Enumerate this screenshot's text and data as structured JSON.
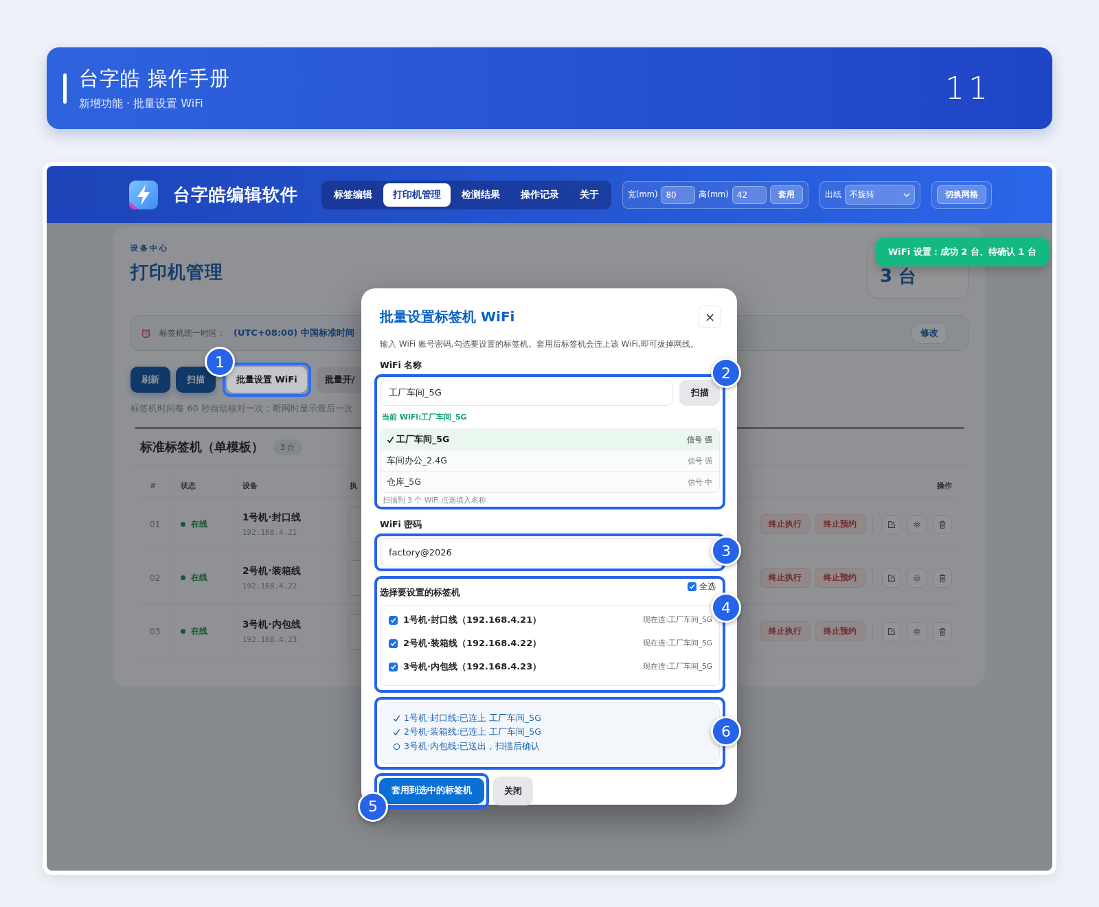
{
  "banner": {
    "title": "台字皓 操作手册",
    "subtitle": "新增功能 · 批量设置 WiFi",
    "page": "11"
  },
  "app": {
    "name": "台字皓编辑软件",
    "tabs": [
      {
        "label": "标签编辑",
        "selected": false
      },
      {
        "label": "打印机管理",
        "selected": true
      },
      {
        "label": "检测结果",
        "selected": false
      },
      {
        "label": "操作记录",
        "selected": false
      },
      {
        "label": "关于",
        "selected": false
      }
    ],
    "width_label": "宽(mm)",
    "width_value": "80",
    "height_label": "高(mm)",
    "height_value": "42",
    "apply_size": "套用",
    "paper_label": "出纸",
    "paper_value": "不旋转",
    "grid_button": "切换网格"
  },
  "page": {
    "eyebrow": "设备中心",
    "title": "打印机管理",
    "stat": "3 台",
    "timezone": {
      "label": "标签机统一时区：",
      "value": "(UTC+08:00) 中国标准时间",
      "edit": "修改"
    },
    "actions": [
      {
        "label": "刷新",
        "kind": "primary"
      },
      {
        "label": "扫描",
        "kind": "primary"
      },
      {
        "label": "批量设置 WiFi",
        "kind": "secondary",
        "callout": "1"
      },
      {
        "label": "批量开/",
        "kind": "secondary"
      }
    ],
    "hint": "标签机时间每 60 秒自动核对一次；断网时显示最后一次",
    "section": {
      "title": "标准标签机（单模板）",
      "count": "3 台"
    },
    "table": {
      "columns": [
        "#",
        "状态",
        "设备",
        "执"
      ],
      "actions_column": "操作",
      "rows": [
        {
          "index": "01",
          "status": "在线",
          "online": true,
          "name": "1号机·封口线",
          "ip": "192.168.4.21",
          "buttons": [
            "终止执行",
            "终止预约"
          ]
        },
        {
          "index": "02",
          "status": "在线",
          "online": true,
          "name": "2号机·装箱线",
          "ip": "192.168.4.22",
          "buttons": [
            "终止执行",
            "终止预约"
          ]
        },
        {
          "index": "03",
          "status": "在线",
          "online": true,
          "name": "3号机·内包线",
          "ip": "192.168.4.23",
          "buttons": [
            "终止执行",
            "终止预约"
          ]
        }
      ]
    }
  },
  "toast": "WiFi 设置：成功 2 台、待确认 1 台",
  "dialog": {
    "title": "批量设置标签机 WiFi",
    "close": "×",
    "description": "输入 WiFi 账号密码,勾选要设置的标签机。套用后标签机会连上该 WiFi,即可拔掉网线。",
    "wifi_name": {
      "label": "WiFi 名称",
      "value": "工厂车间_5G",
      "scan": "扫描",
      "current": "当前 WiFi:工厂车间_5G",
      "callout": "2",
      "networks": [
        {
          "name": "工厂车间_5G",
          "signal": "信号 强",
          "selected": true
        },
        {
          "name": "车间办公_2.4G",
          "signal": "信号 强",
          "selected": false
        },
        {
          "name": "仓库_5G",
          "signal": "信号 中",
          "selected": false
        }
      ],
      "footer": "扫描到 3 个 WiFi,点选填入名称"
    },
    "password": {
      "label": "WiFi 密码",
      "value": "factory@2026",
      "callout": "3"
    },
    "printers": {
      "title": "选择要设置的标签机",
      "select_all": {
        "label": "全选",
        "checked": true
      },
      "callout": "4",
      "items": [
        {
          "label": "1号机·封口线（192.168.4.21）",
          "current": "现在连:工厂车间_5G",
          "checked": true
        },
        {
          "label": "2号机·装箱线（192.168.4.22）",
          "current": "现在连:工厂车间_5G",
          "checked": true
        },
        {
          "label": "3号机·内包线（192.168.4.23）",
          "current": "现在连:工厂车间_5G",
          "checked": true
        }
      ]
    },
    "results": {
      "callout": "6",
      "items": [
        {
          "text": "1号机·封口线:已连上 工厂车间_5G",
          "kind": "done"
        },
        {
          "text": "2号机·装箱线:已连上 工厂车间_5G",
          "kind": "done"
        },
        {
          "text": "3号机·内包线:已送出，扫描后确认",
          "kind": "pending"
        }
      ]
    },
    "apply": {
      "label": "套用到选中的标签机",
      "callout": "5"
    },
    "cancel": "关闭"
  }
}
